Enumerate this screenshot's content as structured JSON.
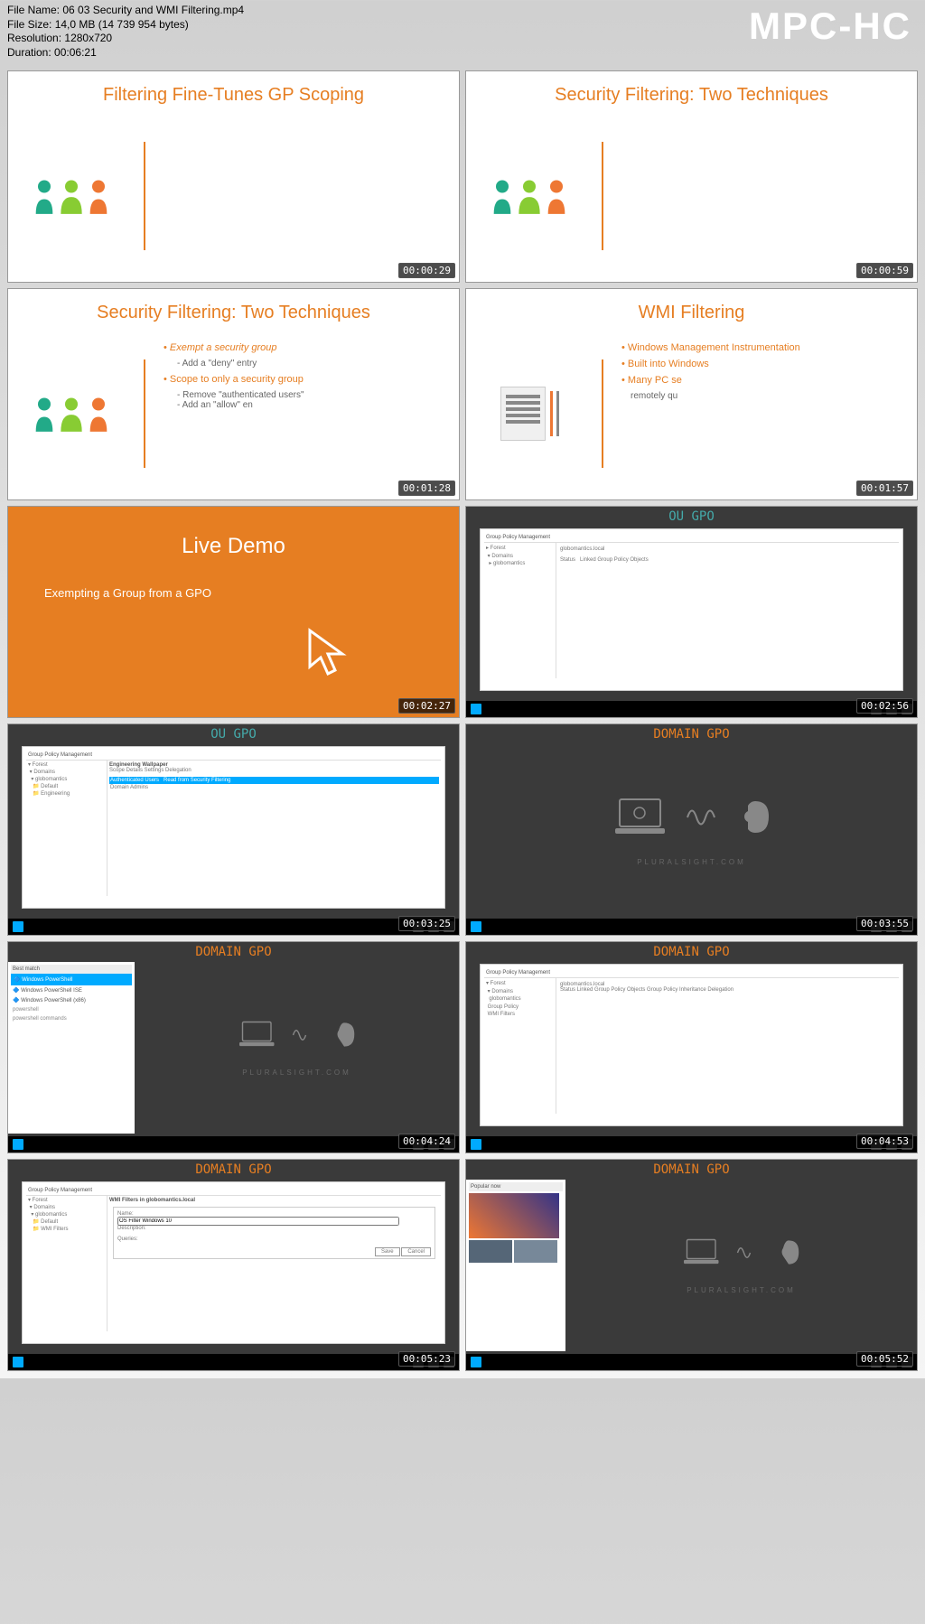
{
  "header": {
    "filename_label": "File Name:",
    "filename": "06 03 Security and WMI Filtering.mp4",
    "filesize_label": "File Size:",
    "filesize": "14,0 MB (14 739 954 bytes)",
    "resolution_label": "Resolution:",
    "resolution": "1280x720",
    "duration_label": "Duration:",
    "duration": "00:06:21",
    "watermark": "MPC-HC"
  },
  "thumbs": [
    {
      "title": "Filtering Fine-Tunes GP Scoping",
      "time": "00:00:29",
      "type": "slide-people"
    },
    {
      "title": "Security Filtering: Two Techniques",
      "time": "00:00:59",
      "type": "slide-people"
    },
    {
      "title": "Security Filtering: Two Techniques",
      "time": "00:01:28",
      "type": "slide-bullets",
      "bullets": {
        "b1": "Exempt a security group",
        "s1": "Add a \"deny\" entry",
        "b2": "Scope to only a security group",
        "s2": "Remove \"authenticated users\"",
        "s3": "Add an \"allow\" en"
      }
    },
    {
      "title": "WMI Filtering",
      "time": "00:01:57",
      "type": "slide-wmi",
      "bullets": {
        "b1": "Windows Management Instrumentation",
        "b2": "Built into Windows",
        "b3": "Many PC se",
        "b4": "remotely qu"
      }
    },
    {
      "title": "Live Demo",
      "subtitle": "Exempting a Group from a GPO",
      "time": "00:02:27",
      "type": "orange"
    },
    {
      "title": "OU GPO",
      "time": "00:02:56",
      "type": "desktop-window",
      "color": "teal"
    },
    {
      "title": "OU GPO",
      "time": "00:03:25",
      "type": "desktop-window",
      "color": "teal"
    },
    {
      "title": "DOMAIN GPO",
      "time": "00:03:55",
      "type": "graphic",
      "brand": "PLURALSIGHT.COM"
    },
    {
      "title": "DOMAIN GPO",
      "time": "00:04:24",
      "type": "desktop-search"
    },
    {
      "title": "DOMAIN GPO",
      "time": "00:04:53",
      "type": "desktop-window",
      "color": "orange"
    },
    {
      "title": "DOMAIN GPO",
      "time": "00:05:23",
      "type": "desktop-window",
      "color": "orange"
    },
    {
      "title": "DOMAIN GPO",
      "time": "00:05:52",
      "type": "desktop-news",
      "brand": "PLURALSIGHT.COM"
    }
  ]
}
